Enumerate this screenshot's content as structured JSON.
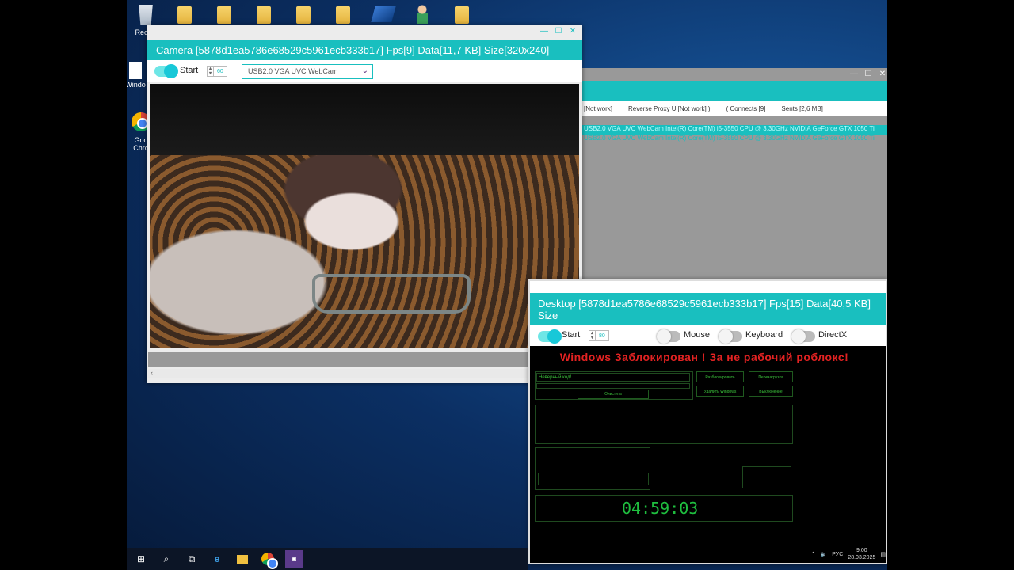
{
  "desktop_icons": [
    {
      "label": "Recycl",
      "kind": "recycle"
    },
    {
      "label": "",
      "kind": "folder"
    },
    {
      "label": "",
      "kind": "folder"
    },
    {
      "label": "",
      "kind": "folder"
    },
    {
      "label": "",
      "kind": "folder"
    },
    {
      "label": "",
      "kind": "folder"
    },
    {
      "label": "",
      "kind": "app"
    },
    {
      "label": "",
      "kind": "person"
    },
    {
      "label": "",
      "kind": "folder"
    }
  ],
  "desktop_side_labels": {
    "windo": "Windo",
    "chrome_1": "Goo",
    "chrome_2": "Chro"
  },
  "camera": {
    "title": "Camera [5878d1ea5786e68529c5961ecb333b17]  Fps[9] Data[11,7 KB] Size[320x240]",
    "start_label": "Start",
    "spin_value": "60",
    "device": "USB2.0 VGA UVC WebCam",
    "scroll_left": "‹"
  },
  "proxy": {
    "headers": [
      "[Not work]",
      "Reverse Proxy U [Not work] )",
      "( Connects [9]",
      "Sents [2,6 MB]"
    ],
    "rows": [
      "                              ",
      "USB2.0 VGA UVC WebCam   Intel(R) Core(TM) i5-3550 CPU @ 3.30GHz   NVIDIA GeForce GTX 1050 Ti",
      "USB2.0 VGA UVC WebCam   Intel(R) Core(TM) i5-3550 CPU @ 3.30GHz   NVIDIA GeForce GTX 1050 Ti"
    ]
  },
  "desktop_win": {
    "title": "Desktop [5878d1ea5786e68529c5961ecb333b17]  Fps[15] Data[40,5 KB] Size",
    "start_label": "Start",
    "spin_value": "80",
    "mouse_label": "Mouse",
    "keyboard_label": "Keyboard",
    "directx_label": "DirectX",
    "headline": "Windows Заблокирован ! За не рабочий роблокс!",
    "input_value": "Неверный код!",
    "btn_unlock": "Разблокировать",
    "btn_reboot": "Перезагрузка",
    "btn_delete": "Удалить Windows",
    "btn_shutdown": "Выключение",
    "btn_clear": "Очистить",
    "timer": "04:59:03",
    "tray_lang": "РУС",
    "tray_time": "9:00",
    "tray_date": "28.03.2025"
  },
  "taskbar": {
    "icons": [
      "windows-start-icon",
      "search-icon",
      "task-view-icon",
      "edge-icon",
      "explorer-icon",
      "chrome-icon",
      "rat-client-icon"
    ]
  }
}
